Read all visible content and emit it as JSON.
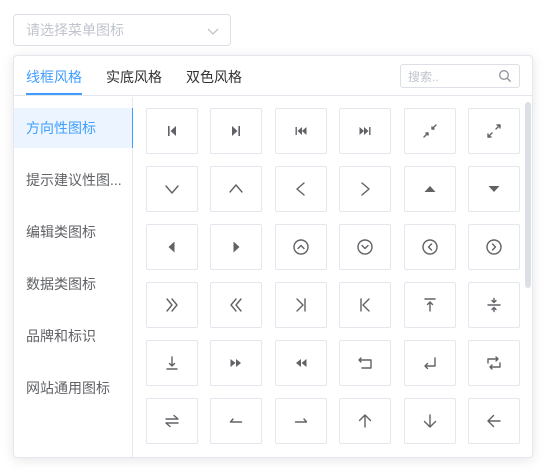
{
  "select": {
    "placeholder": "请选择菜单图标"
  },
  "tabs": [
    {
      "label": "线框风格",
      "active": true
    },
    {
      "label": "实底风格",
      "active": false
    },
    {
      "label": "双色风格",
      "active": false
    }
  ],
  "search": {
    "placeholder": "搜索.."
  },
  "sidebar": {
    "items": [
      {
        "label": "方向性图标",
        "active": true
      },
      {
        "label": "提示建议性图..."
      },
      {
        "label": "编辑类图标"
      },
      {
        "label": "数据类图标"
      },
      {
        "label": "品牌和标识"
      },
      {
        "label": "网站通用图标"
      }
    ]
  },
  "colors": {
    "accent": "#409eff",
    "icon": "#606266"
  },
  "icons": [
    "step-backward-icon",
    "step-forward-icon",
    "fast-backward-icon",
    "fast-forward-icon",
    "shrink-icon",
    "arrows-alt-icon",
    "down-icon",
    "up-icon",
    "left-icon",
    "right-icon",
    "caret-up-icon",
    "caret-down-icon",
    "caret-left-icon",
    "caret-right-icon",
    "up-circle-icon",
    "down-circle-icon",
    "left-circle-icon",
    "right-circle-icon",
    "double-right-icon",
    "double-left-icon",
    "vertical-left-icon",
    "vertical-right-icon",
    "vertical-align-top-icon",
    "vertical-align-middle-icon",
    "vertical-align-bottom-icon",
    "forward-icon",
    "backward-icon",
    "rollback-icon",
    "enter-icon",
    "retweet-icon",
    "swap-icon",
    "swap-left-icon",
    "swap-right-icon",
    "arrow-up-icon",
    "arrow-down-icon",
    "arrow-left-icon"
  ]
}
